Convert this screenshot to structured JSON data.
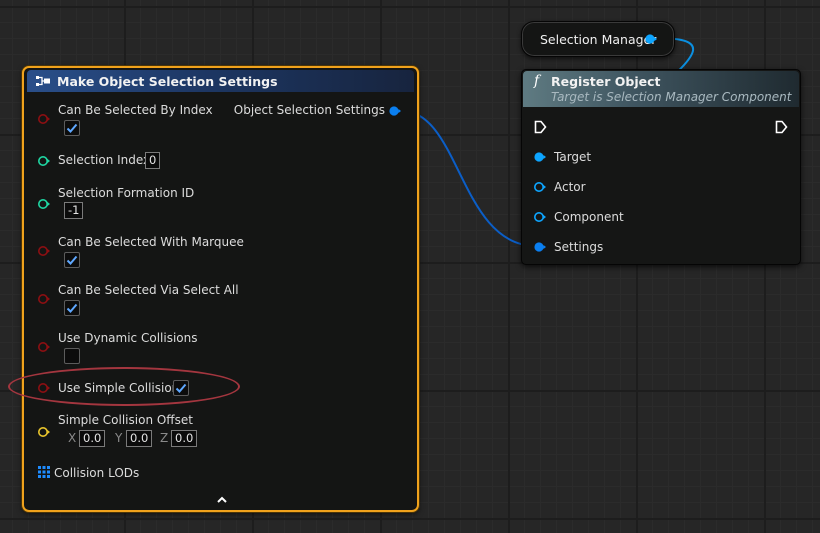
{
  "make_node": {
    "title": "Make Object Selection Settings",
    "pins": {
      "can_be_selected_by_index": {
        "label": "Can Be Selected By Index",
        "checked": true
      },
      "selection_index": {
        "label": "Selection Index",
        "value": "0"
      },
      "selection_formation_id": {
        "label": "Selection Formation ID",
        "value": "-1"
      },
      "can_be_selected_with_marquee": {
        "label": "Can Be Selected With Marquee",
        "checked": true
      },
      "can_be_selected_via_select_all": {
        "label": "Can Be Selected Via Select All",
        "checked": true
      },
      "use_dynamic_collisions": {
        "label": "Use Dynamic Collisions",
        "checked": false
      },
      "use_simple_collision": {
        "label": "Use Simple Collision",
        "checked": true
      },
      "simple_collision_offset": {
        "label": "Simple Collision Offset",
        "x_label": "X",
        "x_value": "0.0",
        "y_label": "Y",
        "y_value": "0.0",
        "z_label": "Z",
        "z_value": "0.0"
      },
      "collision_lods": {
        "label": "Collision LODs"
      }
    },
    "output": {
      "label": "Object Selection Settings"
    },
    "collapse_icon": "chevron-up-icon"
  },
  "selection_manager_node": {
    "label": "Selection Manager"
  },
  "register_node": {
    "title": "Register Object",
    "subtitle": "Target is Selection Manager Component",
    "function_icon": "f",
    "pins": {
      "target": {
        "label": "Target"
      },
      "actor": {
        "label": "Actor"
      },
      "component": {
        "label": "Component"
      },
      "settings": {
        "label": "Settings"
      }
    }
  },
  "colors": {
    "selected_outline": "#f0a21c",
    "bool_pin": "#8c0f12",
    "int_pin": "#1fd6a2",
    "struct_pin": "#0088ff",
    "vector_pin": "#e8c42c",
    "object_pin": "#0da5ff",
    "exec_pin": "#ffffff",
    "highlight_ellipse": "#a4363f"
  }
}
